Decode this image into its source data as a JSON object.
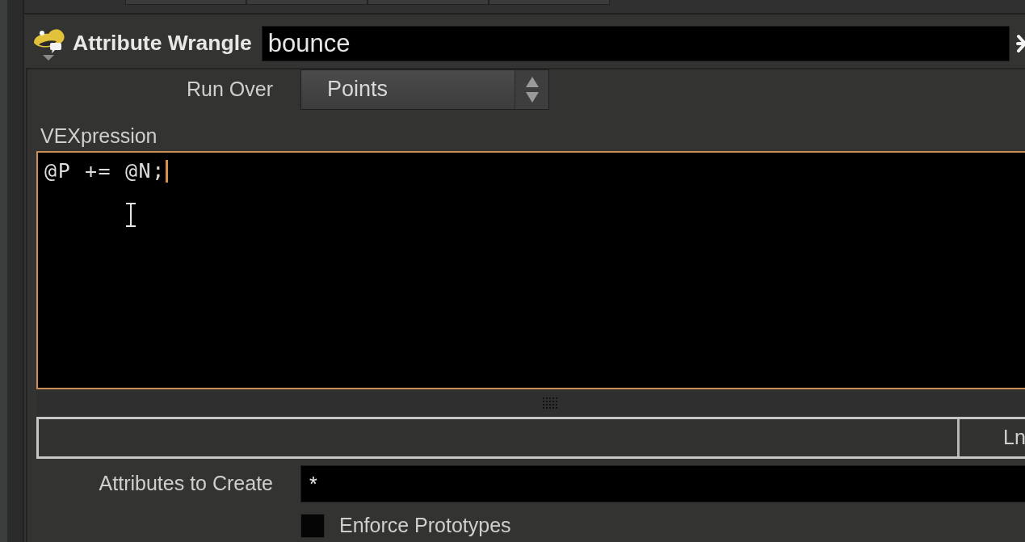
{
  "node": {
    "type_label": "Attribute Wrangle",
    "name": "bounce"
  },
  "parameters": {
    "run_over": {
      "label": "Run Over",
      "value": "Points"
    },
    "vexpression": {
      "label": "VEXpression",
      "code": "@P += @N;",
      "focused": true
    },
    "status_bar": {
      "line_label": "Ln"
    },
    "attributes_to_create": {
      "label": "Attributes to Create",
      "value": "*"
    },
    "enforce_prototypes": {
      "label": "Enforce Prototypes",
      "checked": false
    }
  }
}
